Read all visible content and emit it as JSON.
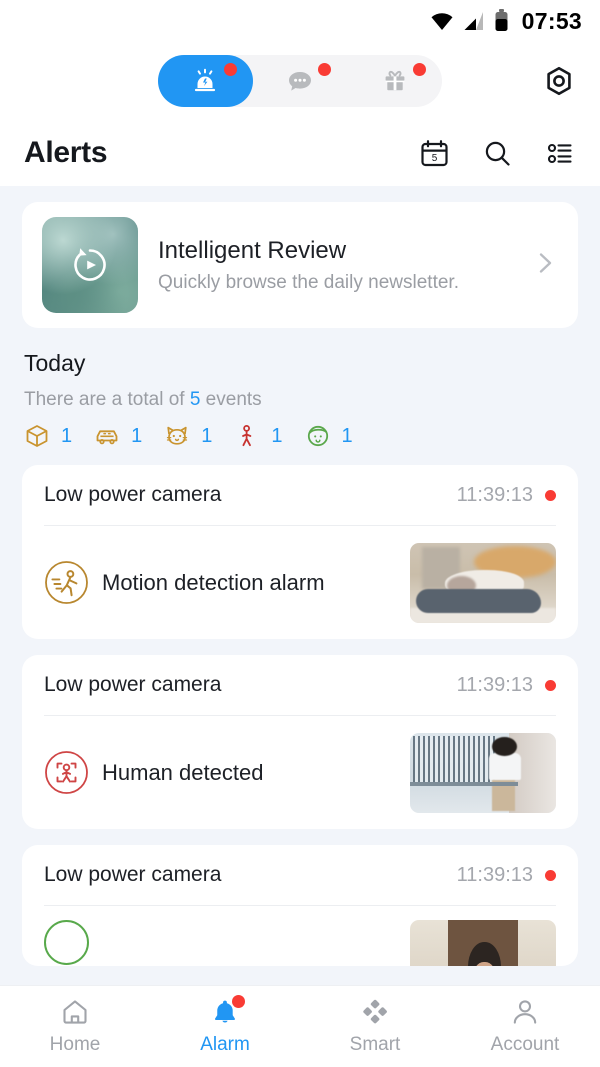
{
  "status_bar": {
    "time": "07:53",
    "icons": [
      "wifi-icon",
      "cellular-signal-icon",
      "battery-icon"
    ]
  },
  "top_segment": {
    "items": [
      {
        "name": "alarm-siren-icon",
        "active": true,
        "badge": true
      },
      {
        "name": "message-chat-icon",
        "active": false,
        "badge": true
      },
      {
        "name": "gift-icon",
        "active": false,
        "badge": true
      }
    ],
    "settings_label": "settings-gear-icon",
    "active_color": "#2196f3",
    "badge_color": "#f93b34"
  },
  "header": {
    "title": "Alerts",
    "calendar_day": "5",
    "actions": [
      "calendar-icon",
      "search-icon",
      "filter-list-icon"
    ]
  },
  "review_card": {
    "title": "Intelligent Review",
    "subtitle": "Quickly browse the daily newsletter.",
    "thumb_icon": "replay-video-icon",
    "chevron": "chevron-right-icon"
  },
  "today": {
    "title": "Today",
    "total_prefix": "There are a total of ",
    "total_count": "5",
    "total_suffix": " events",
    "count_color": "#2196f3",
    "categories": [
      {
        "icon": "package-box-icon",
        "count": "1",
        "color": "#c9942f"
      },
      {
        "icon": "vehicle-car-icon",
        "count": "1",
        "color": "#c9942f"
      },
      {
        "icon": "pet-cat-icon",
        "count": "1",
        "color": "#c9942f"
      },
      {
        "icon": "motion-person-icon",
        "count": "1",
        "color": "#c7322f"
      },
      {
        "icon": "face-recognition-icon",
        "count": "1",
        "color": "#5ba84c"
      }
    ]
  },
  "alerts": [
    {
      "device": "Low power camera",
      "time": "11:39:13",
      "unread": true,
      "event_type": "Motion detection alarm",
      "event_icon": "motion-detection-icon",
      "event_color": "#b8872f",
      "thumb": "cat-on-cushion-thumbnail"
    },
    {
      "device": "Low power camera",
      "time": "11:39:13",
      "unread": true,
      "event_type": "Human detected",
      "event_icon": "human-detected-icon",
      "event_color": "#cf4545",
      "thumb": "man-by-fence-thumbnail"
    },
    {
      "device": "Low power camera",
      "time": "11:39:13",
      "unread": true,
      "event_type": "",
      "event_icon": "face-detected-icon",
      "event_color": "#58a94b",
      "thumb": "person-head-thumbnail"
    }
  ],
  "bottom_nav": {
    "items": [
      {
        "label": "Home",
        "icon": "home-icon",
        "active": false,
        "badge": false
      },
      {
        "label": "Alarm",
        "icon": "bell-icon",
        "active": true,
        "badge": true
      },
      {
        "label": "Smart",
        "icon": "smart-diamonds-icon",
        "active": false,
        "badge": false
      },
      {
        "label": "Account",
        "icon": "account-person-icon",
        "active": false,
        "badge": false
      }
    ],
    "active_color": "#2196f3",
    "inactive_color": "#a1a4aa"
  }
}
